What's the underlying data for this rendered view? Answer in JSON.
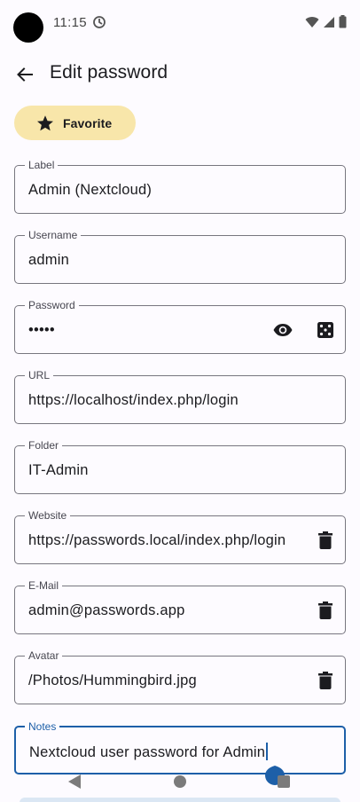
{
  "status_bar": {
    "time": "11:15",
    "icons": [
      "app-notification-icon",
      "wifi-icon",
      "signal-icon",
      "battery-icon"
    ]
  },
  "app_bar": {
    "back_icon": "arrow-back-icon",
    "title": "Edit password"
  },
  "favorite_chip": {
    "icon": "star-icon",
    "label": "Favorite",
    "color": "#f8e6aa"
  },
  "fields": {
    "label": {
      "label": "Label",
      "value": "Admin (Nextcloud)"
    },
    "username": {
      "label": "Username",
      "value": "admin"
    },
    "password": {
      "label": "Password",
      "value": "•••••",
      "icons": [
        "eye-icon",
        "dice-icon"
      ]
    },
    "url": {
      "label": "URL",
      "value": "https://localhost/index.php/login"
    },
    "folder": {
      "label": "Folder",
      "value": "IT-Admin"
    },
    "website": {
      "label": "Website",
      "value": "https://passwords.local/index.php/login",
      "icons": [
        "delete-icon"
      ]
    },
    "email": {
      "label": "E-Mail",
      "value": "admin@passwords.app",
      "icons": [
        "delete-icon"
      ]
    },
    "avatar": {
      "label": "Avatar",
      "value": "/Photos/Hummingbird.jpg",
      "icons": [
        "delete-icon"
      ]
    },
    "notes": {
      "label": "Notes",
      "value": "Nextcloud user password for Admin",
      "focused": true
    }
  },
  "colors": {
    "accent": "#1d5fa8",
    "outline": "#77767f",
    "background": "#fdfbff"
  },
  "nav_bar": {
    "icons": [
      "nav-back-icon",
      "nav-home-icon",
      "nav-recents-icon"
    ]
  }
}
